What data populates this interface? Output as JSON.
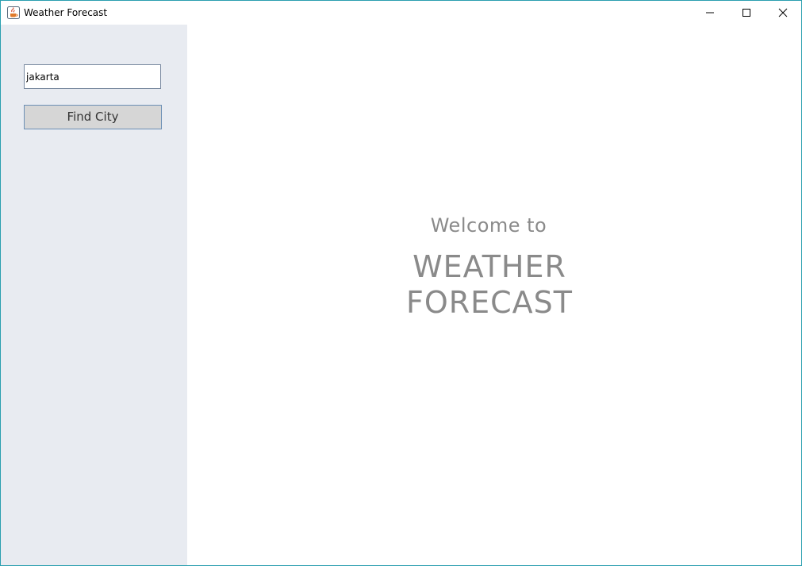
{
  "window": {
    "title": "Weather Forecast",
    "accent_border": "#2a9fb0",
    "app_icon": "java-cup-icon"
  },
  "titlebar_controls": {
    "minimize_icon": "minimize-icon",
    "maximize_icon": "maximize-icon",
    "close_icon": "close-icon"
  },
  "sidebar": {
    "background": "#e8ebf1",
    "city_input_value": "jakarta",
    "find_button_label": "Find City"
  },
  "main": {
    "welcome_text": "Welcome to",
    "app_name_line1": "WEATHER",
    "app_name_line2": "FORECAST",
    "text_color": "#8a8a8a"
  }
}
